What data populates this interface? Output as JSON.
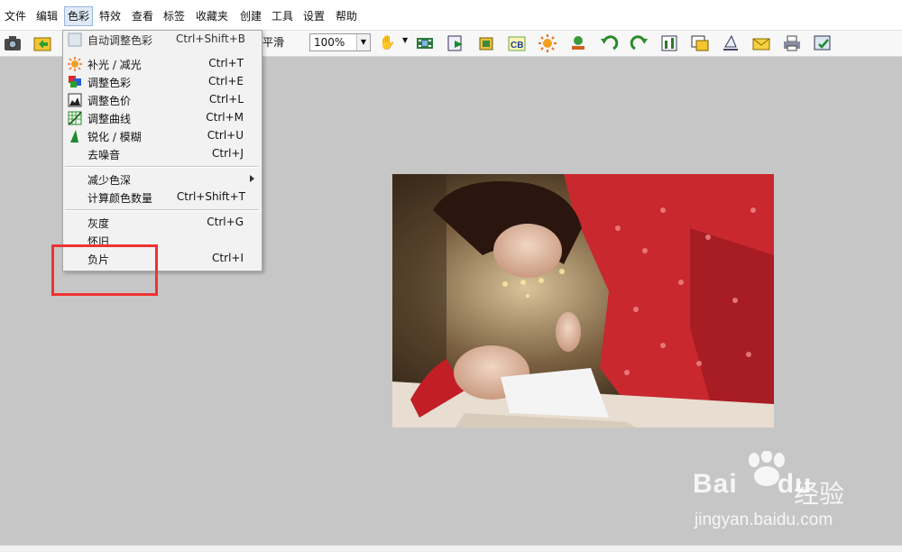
{
  "menubar": {
    "items": [
      "文件",
      "编辑",
      "色彩",
      "特效",
      "查看",
      "标签",
      "收藏夹",
      "创建",
      "工具",
      "设置",
      "帮助"
    ],
    "active_index": 2
  },
  "toolbar": {
    "smooth_label": "平滑",
    "zoom_value": "100%",
    "icons": [
      "camera-icon",
      "open-folder-icon",
      "save-icon",
      "copy-icon",
      "paste-icon",
      "zoom-in-icon",
      "undo-icon",
      "redo-icon",
      "hand-icon",
      "filmstrip-icon",
      "export-icon",
      "crop-icon",
      "cb-icon",
      "sun-icon",
      "stamp-icon",
      "rotate-left-icon",
      "rotate-right-icon",
      "levels-icon",
      "slideshow-icon",
      "scanner-icon",
      "email-icon",
      "printer-icon",
      "settings-check-icon"
    ]
  },
  "color_menu": {
    "items": [
      {
        "label": "自动调整色彩",
        "shortcut": "Ctrl+Shift+B",
        "icon": "auto-color-icon"
      },
      {
        "label": "补光 / 减光",
        "shortcut": "Ctrl+T",
        "icon": "sun-icon"
      },
      {
        "label": "调整色彩",
        "shortcut": "Ctrl+E",
        "icon": "color-squares-icon"
      },
      {
        "label": "调整色价",
        "shortcut": "Ctrl+L",
        "icon": "histogram-icon"
      },
      {
        "label": "调整曲线",
        "shortcut": "Ctrl+M",
        "icon": "curve-grid-icon"
      },
      {
        "label": "锐化 / 模糊",
        "shortcut": "Ctrl+U",
        "icon": "sharpen-icon"
      },
      {
        "label": "去噪音",
        "shortcut": "Ctrl+J"
      },
      {
        "label": "减少色深",
        "shortcut": "",
        "submenu": true
      },
      {
        "label": "计算颜色数量",
        "shortcut": "Ctrl+Shift+T"
      },
      {
        "label": "灰度",
        "shortcut": "Ctrl+G"
      },
      {
        "label": "怀旧",
        "shortcut": ""
      },
      {
        "label": "负片",
        "shortcut": "Ctrl+I"
      }
    ]
  },
  "watermark": {
    "logo_left": "Bai",
    "logo_right": "du",
    "brand_cn": "经验",
    "url": "jingyan.baidu.com"
  },
  "colors": {
    "highlight_box": "#ee3333",
    "canvas_bg": "#c6c6c6",
    "menu_bg": "#f2f2f2"
  }
}
